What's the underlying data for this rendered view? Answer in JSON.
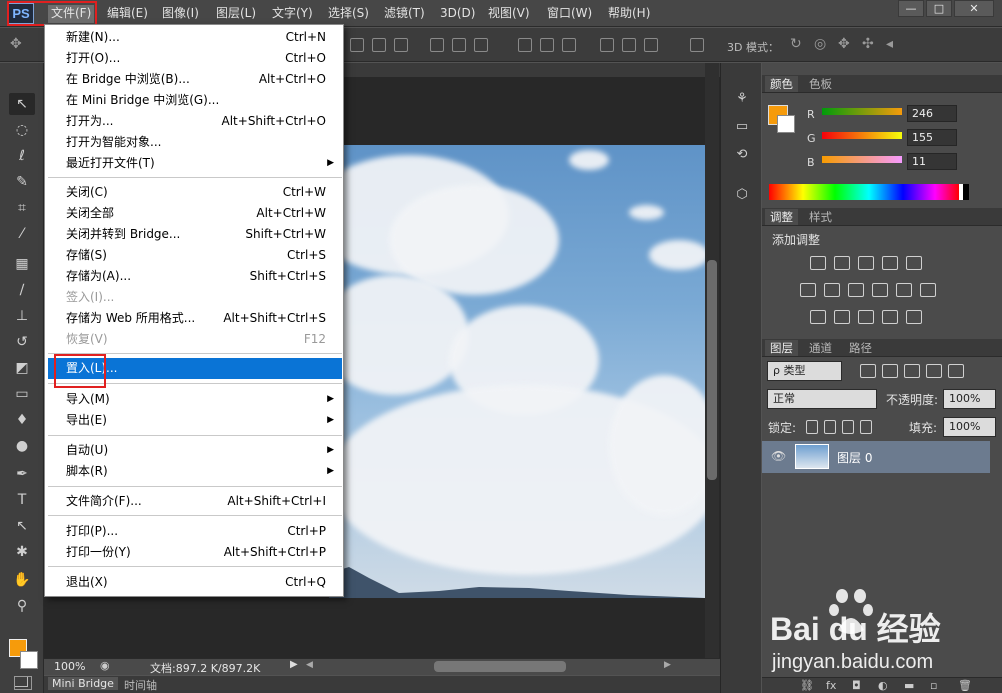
{
  "app": {
    "logo": "PS"
  },
  "menubar": {
    "items": [
      "文件(F)",
      "编辑(E)",
      "图像(I)",
      "图层(L)",
      "文字(Y)",
      "选择(S)",
      "滤镜(T)",
      "3D(D)",
      "视图(V)",
      "窗口(W)",
      "帮助(H)"
    ]
  },
  "window_controls": {
    "minimize": "—",
    "restore": "□",
    "close": "✕"
  },
  "options_bar": {
    "three_d_mode_label": "3D 模式："
  },
  "file_menu": {
    "items": [
      {
        "label": "新建(N)...",
        "shortcut": "Ctrl+N"
      },
      {
        "label": "打开(O)...",
        "shortcut": "Ctrl+O"
      },
      {
        "label": "在 Bridge 中浏览(B)...",
        "shortcut": "Alt+Ctrl+O"
      },
      {
        "label": "在 Mini Bridge 中浏览(G)...",
        "shortcut": ""
      },
      {
        "label": "打开为...",
        "shortcut": "Alt+Shift+Ctrl+O"
      },
      {
        "label": "打开为智能对象...",
        "shortcut": ""
      },
      {
        "label": "最近打开文件(T)",
        "shortcut": ""
      },
      {
        "label": "关闭(C)",
        "shortcut": "Ctrl+W"
      },
      {
        "label": "关闭全部",
        "shortcut": "Alt+Ctrl+W"
      },
      {
        "label": "关闭并转到 Bridge...",
        "shortcut": "Shift+Ctrl+W"
      },
      {
        "label": "存储(S)",
        "shortcut": "Ctrl+S"
      },
      {
        "label": "存储为(A)...",
        "shortcut": "Shift+Ctrl+S"
      },
      {
        "label": "签入(I)...",
        "shortcut": ""
      },
      {
        "label": "存储为 Web 所用格式...",
        "shortcut": "Alt+Shift+Ctrl+S"
      },
      {
        "label": "恢复(V)",
        "shortcut": "F12"
      },
      {
        "label": "置入(L)...",
        "shortcut": ""
      },
      {
        "label": "导入(M)",
        "shortcut": ""
      },
      {
        "label": "导出(E)",
        "shortcut": ""
      },
      {
        "label": "自动(U)",
        "shortcut": ""
      },
      {
        "label": "脚本(R)",
        "shortcut": ""
      },
      {
        "label": "文件简介(F)...",
        "shortcut": "Alt+Shift+Ctrl+I"
      },
      {
        "label": "打印(P)...",
        "shortcut": "Ctrl+P"
      },
      {
        "label": "打印一份(Y)",
        "shortcut": "Alt+Shift+Ctrl+P"
      },
      {
        "label": "退出(X)",
        "shortcut": "Ctrl+Q"
      }
    ]
  },
  "status_bar": {
    "zoom": "100%",
    "doc_info": "文档:897.2 K/897.2K"
  },
  "bottom_tabs": [
    "Mini Bridge",
    "时间轴"
  ],
  "color_panel": {
    "tabs": [
      "颜色",
      "色板"
    ],
    "channels": [
      {
        "label": "R",
        "value": "246"
      },
      {
        "label": "G",
        "value": "155"
      },
      {
        "label": "B",
        "value": "11"
      }
    ],
    "foreground": "#f69b0b",
    "background": "#ffffff"
  },
  "adjustments_panel": {
    "tabs": [
      "调整",
      "样式"
    ],
    "title": "添加调整"
  },
  "layers_panel": {
    "tabs": [
      "图层",
      "通道",
      "路径"
    ],
    "filter_kind": "ρ 类型",
    "blend_mode": "正常",
    "opacity_label": "不透明度:",
    "opacity": "100%",
    "lock_label": "锁定:",
    "fill_label": "填充:",
    "fill": "100%",
    "layers": [
      {
        "name": "图层 0"
      }
    ]
  },
  "watermark": {
    "brand": "Bai du 经验",
    "url": "jingyan.baidu.com"
  }
}
